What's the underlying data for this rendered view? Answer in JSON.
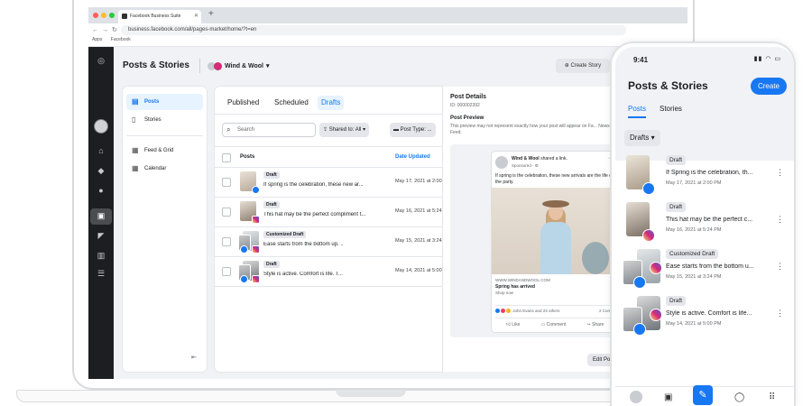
{
  "browser": {
    "tab_title": "Facebook Business Suite",
    "url": "business.facebook.com/all/pages-market/home/?t=en",
    "bookmarks": [
      "Apps",
      "Facebook"
    ]
  },
  "app": {
    "title": "Posts & Stories",
    "account": "Wind & Wool",
    "create_story": "Create Story"
  },
  "sidebar": {
    "items": [
      {
        "label": "Posts",
        "icon": "posts-icon"
      },
      {
        "label": "Stories",
        "icon": "stories-icon"
      },
      {
        "label": "Feed & Grid",
        "icon": "feed-grid-icon"
      },
      {
        "label": "Calendar",
        "icon": "calendar-icon"
      }
    ]
  },
  "main": {
    "tabs": [
      "Published",
      "Scheduled",
      "Drafts"
    ],
    "search_placeholder": "Search",
    "shared_filter": "Shared to: All",
    "post_type_filter": "Post Type: ...",
    "col_posts": "Posts",
    "col_date": "Date Updated",
    "rows": [
      {
        "badge": "Draft",
        "text": "If spring is the celebration, these new ar...",
        "date": "May 17, 2021 at 2:00",
        "network": "facebook"
      },
      {
        "badge": "Draft",
        "text": "This hat may be the perfect compliment t...",
        "date": "May 16, 2021 at 5:24",
        "network": "instagram"
      },
      {
        "badge": "Customized Draft",
        "text": "Ease starts from the bottom up. ..",
        "date": "May 15, 2021 at 3:24",
        "network": "both"
      },
      {
        "badge": "Draft",
        "text": "Style is active. Comfort is life. T...",
        "date": "May 14, 2021 at 5:00",
        "network": "both"
      }
    ]
  },
  "detail": {
    "title": "Post Details",
    "id": "ID: 000002392",
    "preview_title": "Post Preview",
    "preview_note": "This preview may not represent exactly how your post will appear on Fa... News Feed.",
    "card": {
      "page_name": "Wind & Wool",
      "page_action": "shared a link.",
      "sponsored": "Sponsored · ⚙",
      "caption": "If spring is the celebration, these new arrivals are the life of the party.",
      "link_url": "WWW.WINDANDWOOL.COM",
      "link_title": "Spring has arrived",
      "link_sub": "Shop now",
      "reactions": "John Evans and 23 others",
      "comments": "2 Comm",
      "like": "Like",
      "comment": "Comment",
      "share": "Share"
    },
    "edit_button": "Edit Po"
  },
  "phone": {
    "time": "9:41",
    "title": "Posts & Stories",
    "create": "Create",
    "tabs": [
      "Posts",
      "Stories"
    ],
    "filter": "Drafts",
    "rows": [
      {
        "badge": "Draft",
        "text": "If Spring is the celebration, th...",
        "date": "May 17, 2021 at 2:00 PM",
        "network": "facebook"
      },
      {
        "badge": "Draft",
        "text": "This hat may be the perfect c...",
        "date": "May 16, 2021 at 5:24 PM",
        "network": "instagram"
      },
      {
        "badge": "Customized Draft",
        "text": "Ease starts from the bottom u...",
        "date": "May 15, 2021 at 3:24 PM",
        "network": "both"
      },
      {
        "badge": "Draft",
        "text": "Style is active. Comfort is life...",
        "date": "May 14, 2021 at 5:00 PM",
        "network": "both"
      }
    ]
  },
  "colors": {
    "accent": "#1877f2",
    "rail": "#1c1e21",
    "background": "#f0f2f5"
  }
}
